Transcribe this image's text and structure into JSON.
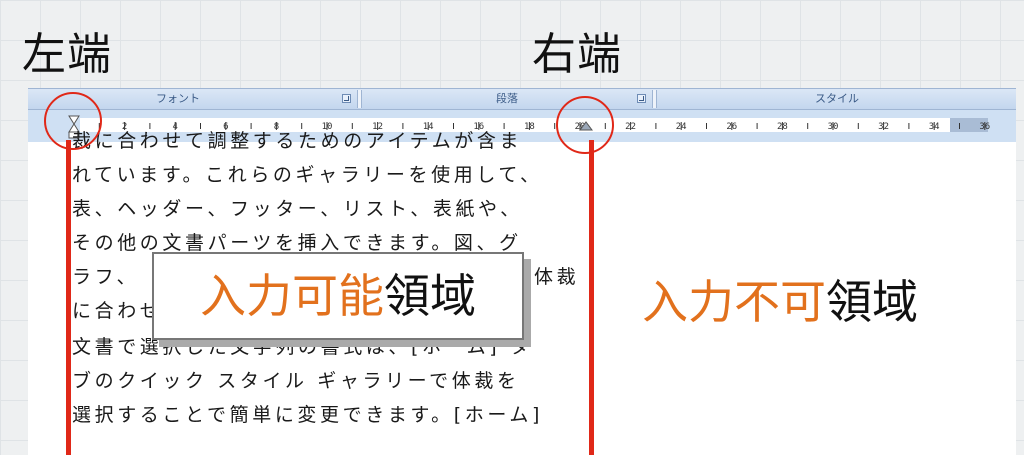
{
  "labels": {
    "left_edge": "左端",
    "right_edge": "右端"
  },
  "ribbon": {
    "groups": [
      {
        "name": "フォント"
      },
      {
        "name": "段落"
      },
      {
        "name": "スタイル"
      }
    ]
  },
  "ruler": {
    "tick_labels": [
      "2",
      "4",
      "6",
      "8",
      "10",
      "12",
      "14",
      "16",
      "18",
      "20",
      "22",
      "24",
      "26",
      "28",
      "30",
      "32",
      "34",
      "36"
    ]
  },
  "document": {
    "lines": [
      "裁に合わせて調整するためのアイテムが含ま",
      "れています。これらのギャラリーを使用して、",
      "表、ヘッダー、フッター、リスト、表紙や、",
      "その他の文書パーツを挿入できます。図、グ",
      "ラフ、",
      "体裁",
      "に合わせ",
      "文書で選択した文字列の書式は、[ホーム] タ",
      "ブのクイック スタイル ギャラリーで体裁を",
      "選択することで簡単に変更できます。[ホーム]"
    ]
  },
  "overlay": {
    "input_area_orange": "入力可能",
    "input_area_black": "領域",
    "no_input_orange": "入力不可",
    "no_input_black": "領域"
  },
  "colors": {
    "accent_orange": "#e2711d",
    "marker_red": "#e02818",
    "ruler_blue": "#cfe0f3"
  }
}
